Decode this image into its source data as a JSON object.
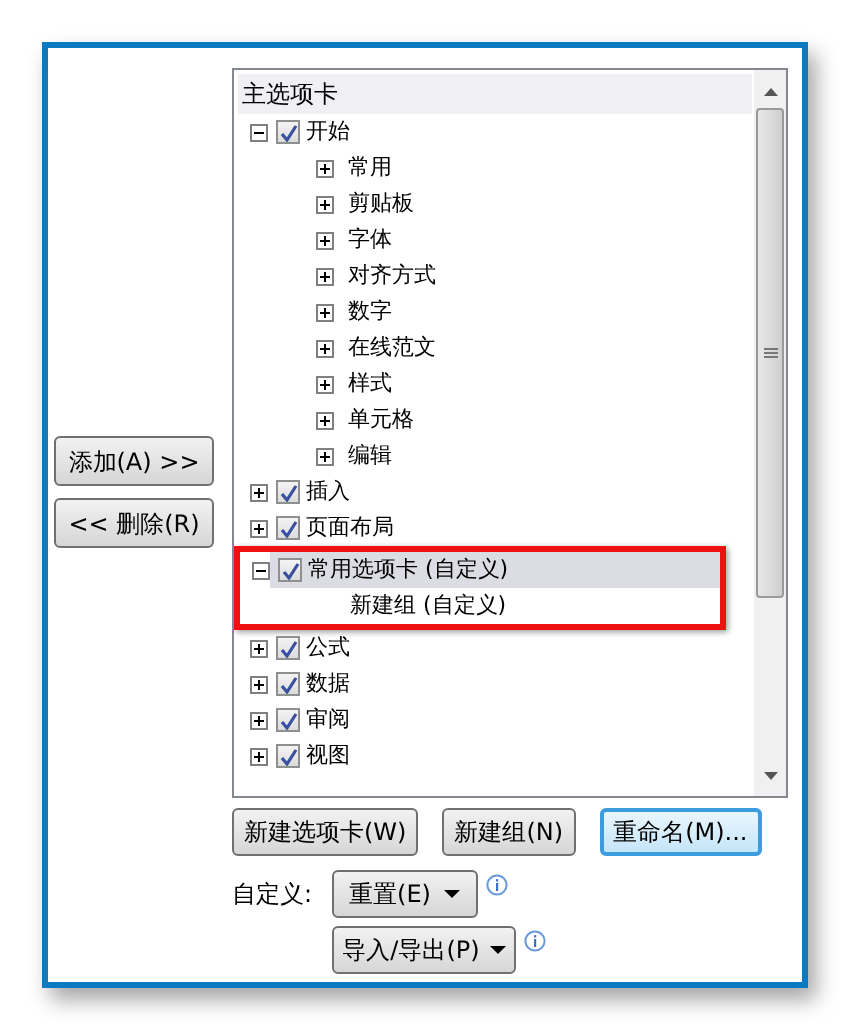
{
  "side_buttons": [
    {
      "label": "添加(A) >>"
    },
    {
      "label": "<< 删除(R)"
    }
  ],
  "tree": {
    "header": "主选项卡",
    "items": [
      {
        "label": "开始",
        "checked": true,
        "expanded": true,
        "selected": false,
        "annotated": false,
        "children": [
          {
            "label": "常用",
            "leaf": false
          },
          {
            "label": "剪贴板",
            "leaf": false
          },
          {
            "label": "字体",
            "leaf": false
          },
          {
            "label": "对齐方式",
            "leaf": false
          },
          {
            "label": "数字",
            "leaf": false
          },
          {
            "label": "在线范文",
            "leaf": false
          },
          {
            "label": "样式",
            "leaf": false
          },
          {
            "label": "单元格",
            "leaf": false
          },
          {
            "label": "编辑",
            "leaf": false
          }
        ]
      },
      {
        "label": "插入",
        "checked": true,
        "expanded": false,
        "selected": false,
        "annotated": false
      },
      {
        "label": "页面布局",
        "checked": true,
        "expanded": false,
        "selected": false,
        "annotated": false
      },
      {
        "label": "常用选项卡 (自定义)",
        "checked": true,
        "expanded": true,
        "selected": true,
        "annotated": true,
        "children": [
          {
            "label": "新建组 (自定义)",
            "leaf": true
          }
        ]
      },
      {
        "label": "公式",
        "checked": true,
        "expanded": false,
        "selected": false,
        "annotated": false
      },
      {
        "label": "数据",
        "checked": true,
        "expanded": false,
        "selected": false,
        "annotated": false
      },
      {
        "label": "审阅",
        "checked": true,
        "expanded": false,
        "selected": false,
        "annotated": false
      },
      {
        "label": "视图",
        "checked": true,
        "expanded": false,
        "selected": false,
        "annotated": false
      }
    ]
  },
  "action_buttons": [
    {
      "label": "新建选项卡(W)",
      "focused": false
    },
    {
      "label": "新建组(N)",
      "focused": false
    },
    {
      "label": "重命名(M)...",
      "focused": true
    }
  ],
  "customize": {
    "label": "自定义:",
    "reset": "重置(E)",
    "import_export": "导入/导出(P)"
  }
}
